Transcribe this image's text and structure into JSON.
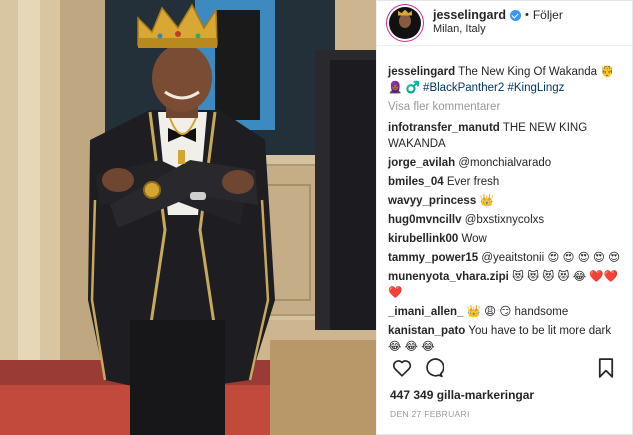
{
  "post": {
    "username": "jesselingard",
    "follow_label": "Följer",
    "location": "Milan, Italy",
    "caption_user": "jesselingard",
    "caption_text": "The New King Of Wakanda 🤴",
    "caption_emoji_line": "🧕🏾 ♂️",
    "caption_tags": [
      "#BlackPanther2",
      "#KingLingz"
    ],
    "more_comments_label": "Visa fler kommentarer",
    "likes": "447 349 gilla-markeringar",
    "date": "DEN 27 FEBRUARI"
  },
  "comments": [
    {
      "user": "infotransfer_manutd",
      "text": "THE NEW KING WAKANDA"
    },
    {
      "user": "jorge_avilah",
      "text": "@monchialvarado"
    },
    {
      "user": "bmiles_04",
      "text": "Ever fresh"
    },
    {
      "user": "wavyy_princess",
      "text": "👑"
    },
    {
      "user": "hug0mvncillv",
      "text": "@bxstixnycolxs"
    },
    {
      "user": "kirubellink00",
      "text": "Wow"
    },
    {
      "user": "tammy_power15",
      "text": "@yeaitstonii 😍 😍 😍 😍 😍"
    },
    {
      "user": "munenyota_vhara.zipi",
      "text": "😻 😻 😻 😻 😂 ❤️❤️❤️"
    },
    {
      "user": "_imani_allen_",
      "text": "👑 😩 😏  handsome"
    },
    {
      "user": "kanistan_pato",
      "text": "You have to be lit more dark 😂 😂 😂"
    }
  ],
  "icons": {
    "verified": "verified-badge-icon",
    "like": "heart-icon",
    "comment": "speech-bubble-icon",
    "save": "bookmark-icon"
  },
  "colors": {
    "accent": "#3897f0",
    "link": "#003569",
    "muted": "#999999"
  }
}
